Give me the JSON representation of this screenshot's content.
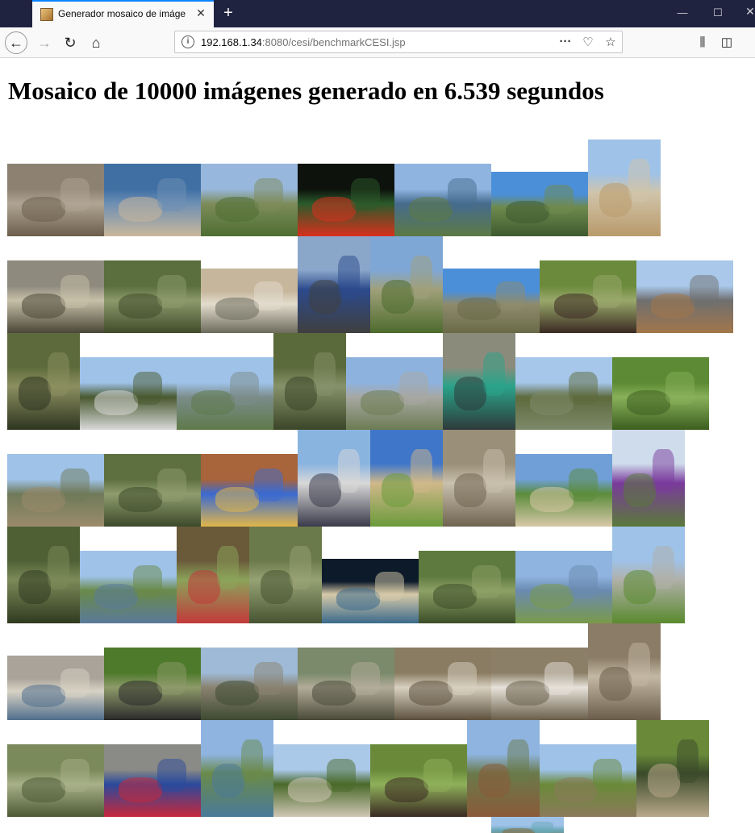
{
  "browser": {
    "tab_title": "Generador mosaico de imágenes",
    "url_host": "192.168.1.34",
    "url_rest": ":8080/cesi/benchmarkCESI.jsp",
    "icons": [
      "favicon-icon",
      "close-icon",
      "plus-icon",
      "minimize-icon",
      "maximize-icon",
      "window-close-icon",
      "back-arrow-icon",
      "forward-arrow-icon",
      "reload-icon",
      "home-icon",
      "info-icon",
      "more-dots-icon",
      "pocket-icon",
      "star-icon",
      "library-icon",
      "sidebar-icon"
    ]
  },
  "page": {
    "heading": "Mosaico de 10000 imágenes generado en 6.539 segundos"
  },
  "mosaic": {
    "description_note": "",
    "tiles": [
      {
        "name": "kangaroos-photo",
        "colors": [
          "#8d8172",
          "#6c5e4c",
          "#b0a593"
        ]
      },
      {
        "name": "marina-photo",
        "colors": [
          "#3f6fa3",
          "#c9b79a",
          "#6e8fb4"
        ]
      },
      {
        "name": "cathedral-garden-photo",
        "colors": [
          "#98b7dc",
          "#4e6e33",
          "#7d8c5a"
        ]
      },
      {
        "name": "red-roses-photo",
        "colors": [
          "#0d120c",
          "#d8301d",
          "#2b5a2a"
        ]
      },
      {
        "name": "river-city-photo",
        "colors": [
          "#8fb4e0",
          "#5c7a44",
          "#466b8e"
        ]
      },
      {
        "name": "mountain-valley-photo",
        "colors": [
          "#4b8fd9",
          "#3e5a2f",
          "#6f8a4d"
        ]
      },
      {
        "name": "heritage-building-photo",
        "colors": [
          "#9fc2e8",
          "#b99a6a",
          "#d0c4aa"
        ]
      },
      {
        "name": "shopping-street-photo",
        "colors": [
          "#8e8a7e",
          "#4a4738",
          "#c7c0a8"
        ]
      },
      {
        "name": "koala-tree-photo",
        "colors": [
          "#5a6e3e",
          "#3f4b2a",
          "#8c9a6b"
        ]
      },
      {
        "name": "seagull-beach-photo",
        "colors": [
          "#c6b79c",
          "#6c6b5c",
          "#e3dccd"
        ]
      },
      {
        "name": "banner-street-photo",
        "colors": [
          "#8aa6c9",
          "#3f3f3f",
          "#2c4a8c"
        ]
      },
      {
        "name": "park-monument-photo",
        "colors": [
          "#7fa7d6",
          "#4d6b2d",
          "#a0a07a"
        ]
      },
      {
        "name": "river-hills-photo",
        "colors": [
          "#4b8fd9",
          "#6a6a48",
          "#8e8b6d"
        ]
      },
      {
        "name": "woman-eagle-photo",
        "colors": [
          "#6b8a3c",
          "#3a2a22",
          "#9aa86b"
        ]
      },
      {
        "name": "colonial-building-photo",
        "colors": [
          "#a9c8ea",
          "#a2764a",
          "#6f6f6f"
        ]
      },
      {
        "name": "bush-trail-photo",
        "colors": [
          "#5d6a3b",
          "#2d3520",
          "#8c8f60"
        ]
      },
      {
        "name": "theatre-building-photo",
        "colors": [
          "#9fc2e8",
          "#d9d9d9",
          "#49592f"
        ]
      },
      {
        "name": "city-riverbank-photo",
        "colors": [
          "#9fc2e8",
          "#5f7a4a",
          "#7b8c8a"
        ]
      },
      {
        "name": "koala-branch-photo",
        "colors": [
          "#5a6a3a",
          "#3b4528",
          "#86926a"
        ]
      },
      {
        "name": "boulevard-photo",
        "colors": [
          "#8eb2de",
          "#6c7b52",
          "#a7a8a2"
        ]
      },
      {
        "name": "mall-shoppers-photo",
        "colors": [
          "#8b8b7c",
          "#2e3a3a",
          "#2aa38a"
        ]
      },
      {
        "name": "town-hall-photo",
        "colors": [
          "#a6c6ea",
          "#7d8a6a",
          "#5d6a3c"
        ]
      },
      {
        "name": "lawn-bird-photo",
        "colors": [
          "#5d8a34",
          "#3c5e1f",
          "#88b05a"
        ]
      },
      {
        "name": "university-building-photo",
        "colors": [
          "#9fc2e8",
          "#9b8b6a",
          "#6f7a5a"
        ]
      },
      {
        "name": "koala-foliage-photo",
        "colors": [
          "#5e7040",
          "#3c4a2a",
          "#8f9c6e"
        ]
      },
      {
        "name": "flower-bouquet-photo",
        "colors": [
          "#a8643a",
          "#e0b64a",
          "#3a6ad1"
        ]
      },
      {
        "name": "costume-crowd-photo",
        "colors": [
          "#8ab4e0",
          "#3a3a4a",
          "#d8d8d8"
        ]
      },
      {
        "name": "clocktower-photo",
        "colors": [
          "#3f76c9",
          "#6a9a3a",
          "#d0b88a"
        ]
      },
      {
        "name": "kangaroo-albino-photo",
        "colors": [
          "#9a8f78",
          "#6f6450",
          "#c9c0ad"
        ]
      },
      {
        "name": "apartments-lawn-photo",
        "colors": [
          "#6f9fd6",
          "#d8c8a8",
          "#5c8c3c"
        ]
      },
      {
        "name": "palms-flowers-photo",
        "colors": [
          "#cfdcec",
          "#5a7a3a",
          "#7a3a9c"
        ]
      },
      {
        "name": "koala-hollow-photo",
        "colors": [
          "#4e6034",
          "#2f3a20",
          "#7b8a58"
        ]
      },
      {
        "name": "convention-centre-photo",
        "colors": [
          "#9fc2e8",
          "#5a7a9a",
          "#6a8a4a"
        ]
      },
      {
        "name": "tram-window-photo",
        "colors": [
          "#6a5a3a",
          "#c23a3a",
          "#8ba35a"
        ]
      },
      {
        "name": "koala-closeup-photo",
        "colors": [
          "#6b7a4a",
          "#465432",
          "#97a274"
        ]
      },
      {
        "name": "night-bay-photo",
        "colors": [
          "#0c1a2a",
          "#3a6a8c",
          "#d6c9a8"
        ]
      },
      {
        "name": "koala-leaves-photo",
        "colors": [
          "#5e7a3e",
          "#3c4e28",
          "#8da066"
        ]
      },
      {
        "name": "riverside-park-photo",
        "colors": [
          "#8fb4e0",
          "#7a9a4a",
          "#6a8ab0"
        ]
      },
      {
        "name": "sculpture-plaza-photo",
        "colors": [
          "#9fc2e8",
          "#5a8a2e",
          "#b0b0a8"
        ]
      },
      {
        "name": "beach-birds-photo",
        "colors": [
          "#a9a39a",
          "#4f6e8c",
          "#d8d2c4"
        ]
      },
      {
        "name": "magpie-lawn-photo",
        "colors": [
          "#4e7a2c",
          "#2a2a2a",
          "#8e9a6a"
        ]
      },
      {
        "name": "memorial-walk-photo",
        "colors": [
          "#9ebad6",
          "#3e4a32",
          "#8a8270"
        ]
      },
      {
        "name": "fountain-square-photo",
        "colors": [
          "#7a8a6a",
          "#4a4a3a",
          "#b2ab99"
        ]
      },
      {
        "name": "roo-group-photo",
        "colors": [
          "#8a7c62",
          "#5d513e",
          "#d8d0c0"
        ]
      },
      {
        "name": "white-kangaroo-photo",
        "colors": [
          "#8c7f68",
          "#6a5e4a",
          "#e6e2da"
        ]
      },
      {
        "name": "grazing-roos-photo",
        "colors": [
          "#8a7c66",
          "#6a5d49",
          "#c3b8a4"
        ]
      },
      {
        "name": "koala-trunk-photo",
        "colors": [
          "#7a8a5a",
          "#4c5a34",
          "#a8b088"
        ]
      },
      {
        "name": "rosella-parrot-photo",
        "colors": [
          "#8a8a86",
          "#c8283a",
          "#2a4a9c"
        ]
      },
      {
        "name": "lake-city-photo",
        "colors": [
          "#8fb4e0",
          "#4a7a9a",
          "#6a8a4a"
        ]
      },
      {
        "name": "war-memorial-photo",
        "colors": [
          "#aac8e8",
          "#cfc6b4",
          "#4a6a2a"
        ]
      },
      {
        "name": "bird-handler-photo",
        "colors": [
          "#6a8a3a",
          "#3a2a22",
          "#8fb05a"
        ]
      },
      {
        "name": "terrace-walkway-photo",
        "colors": [
          "#8fb4e0",
          "#8a5a3a",
          "#6a7a4a"
        ]
      },
      {
        "name": "gothic-church-photo",
        "colors": [
          "#9fc2e8",
          "#8a7a5a",
          "#6a8a3a"
        ]
      },
      {
        "name": "man-owl-photo",
        "colors": [
          "#6a8a3a",
          "#b8a88a",
          "#3a4a2a"
        ]
      },
      {
        "name": "bronze-fountain-photo",
        "colors": [
          "#9fc2e8",
          "#8a6a3a",
          "#6aa8b8"
        ]
      },
      {
        "name": "partial-tree-photo",
        "colors": [
          "#cfdcec",
          "#5a7a3a",
          "#8a9a6a"
        ]
      }
    ]
  }
}
